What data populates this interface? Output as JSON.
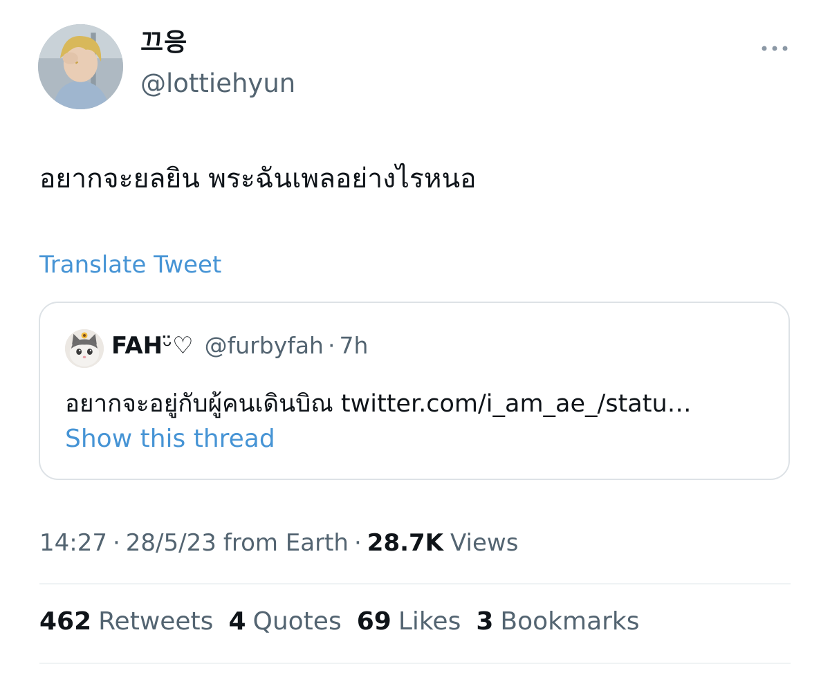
{
  "tweet": {
    "author": {
      "display_name": "끄응",
      "handle": "@lottiehyun"
    },
    "text": "อยากจะยลยิน พระฉันเพลอย่างไรหนอ",
    "translate_label": "Translate Tweet",
    "more_icon": "more-horizontal-icon"
  },
  "quote": {
    "display_name": "FAH",
    "name_emoji": "ᵕ̈♡",
    "handle": "@furbyfah",
    "separator": "·",
    "time": "7h",
    "text": "อยากจะอยู่กับผู้คนเดินบิณ twitter.com/i_am_ae_/statu…",
    "show_thread_label": "Show this thread"
  },
  "meta": {
    "time": "14:27",
    "date": "28/5/23",
    "source": "from Earth",
    "separator": "·",
    "views_count": "28.7K",
    "views_label": "Views"
  },
  "stats": {
    "retweets_count": "462",
    "retweets_label": "Retweets",
    "quotes_count": "4",
    "quotes_label": "Quotes",
    "likes_count": "69",
    "likes_label": "Likes",
    "bookmarks_count": "3",
    "bookmarks_label": "Bookmarks"
  },
  "colors": {
    "link": "#4694d5",
    "secondary_text": "#536471",
    "primary_text": "#0f1419",
    "border": "#dde2e6"
  }
}
